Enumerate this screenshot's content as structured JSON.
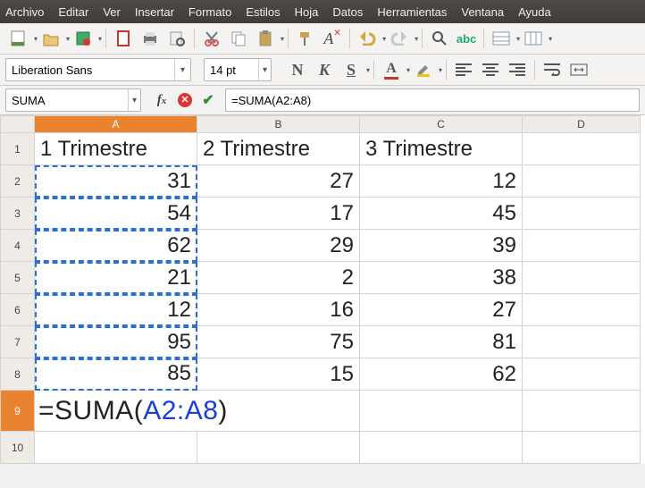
{
  "menu": {
    "items": [
      "Archivo",
      "Editar",
      "Ver",
      "Insertar",
      "Formato",
      "Estilos",
      "Hoja",
      "Datos",
      "Herramientas",
      "Ventana",
      "Ayuda"
    ]
  },
  "font": {
    "name": "Liberation Sans",
    "size": "14 pt"
  },
  "nameBox": "SUMA",
  "formulaInput": "=SUMA(A2:A8)",
  "columns": [
    "A",
    "B",
    "C",
    "D"
  ],
  "rows": [
    "1",
    "2",
    "3",
    "4",
    "5",
    "6",
    "7",
    "8",
    "9",
    "10"
  ],
  "data": {
    "headers": [
      "1 Trimestre",
      "2 Trimestre",
      "3 Trimestre"
    ],
    "r2": [
      "31",
      "27",
      "12"
    ],
    "r3": [
      "54",
      "17",
      "45"
    ],
    "r4": [
      "62",
      "29",
      "39"
    ],
    "r5": [
      "21",
      "2",
      "38"
    ],
    "r6": [
      "12",
      "16",
      "27"
    ],
    "r7": [
      "95",
      "75",
      "81"
    ],
    "r8": [
      "85",
      "15",
      "62"
    ]
  },
  "formulaCell": {
    "pre": "=SUMA(",
    "ref": "A2:A8",
    "post": ")"
  },
  "chart_data": {
    "type": "table",
    "columns": [
      "1 Trimestre",
      "2 Trimestre",
      "3 Trimestre"
    ],
    "rows": [
      [
        31,
        27,
        12
      ],
      [
        54,
        17,
        45
      ],
      [
        62,
        29,
        39
      ],
      [
        21,
        2,
        38
      ],
      [
        12,
        16,
        27
      ],
      [
        95,
        75,
        81
      ],
      [
        85,
        15,
        62
      ]
    ],
    "editing_cell": "A9",
    "editing_formula": "=SUMA(A2:A8)"
  }
}
